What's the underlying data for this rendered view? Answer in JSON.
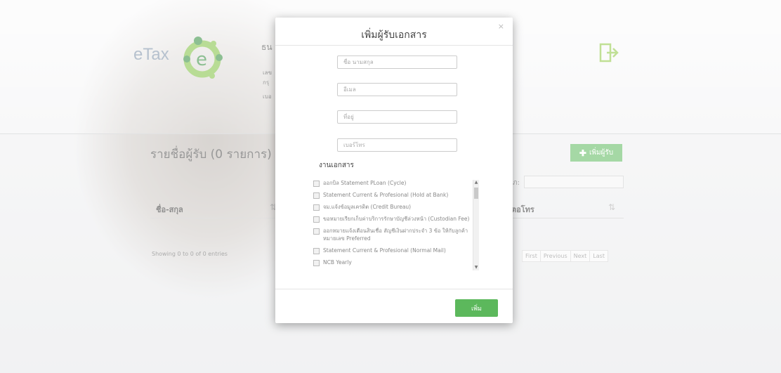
{
  "background": {
    "logo_text": "eTax",
    "header_fragments": [
      "ธน",
      "เลข",
      "กรุ",
      "เบอ"
    ],
    "list_title": "รายชื่อผู้รับ (0 รายการ)",
    "add_button_label": "เพิ่มผู้รับ",
    "search_fragment": "ภ:",
    "table": {
      "col_name": "ชื่อ-สกุล",
      "col_right": "ตอโทร",
      "showing": "Showing 0 to 0 of 0 entries"
    },
    "pager": [
      "First",
      "Previous",
      "Next",
      "Last"
    ]
  },
  "modal": {
    "title": "เพิ่มผู้รับเอกสาร",
    "close": "×",
    "fields": [
      {
        "name": "name-field",
        "placeholder": "ชื่อ นามสกุล"
      },
      {
        "name": "email-field",
        "placeholder": "อีเมล"
      },
      {
        "name": "address-field",
        "placeholder": "ที่อยู่"
      },
      {
        "name": "phone-field",
        "placeholder": "เบอร์โทร"
      }
    ],
    "section_label": "งานเอกสาร",
    "documents": [
      "ออกบิล Statement PLoan (Cycle)",
      "Statement Current & Profesional (Hold at Bank)",
      "จม.แจ้งข้อมูลเครดิต (Credit Bureau)",
      "ขอหมายเรียกเก็บค่าบริการรักษาบัญชีล่วงหน้า (Custodian Fee)",
      "ออกหมายแจ้งเตือนสินเชื่อ สัญชีเงินฝากประจำ 3 ข้อ ให้กับลูกค้าหมายเลข Preferred",
      "Statement Current & Profesional (Normal Mail)",
      "NCB Yearly"
    ],
    "submit_label": "เพิ่ม"
  },
  "colors": {
    "accent_green": "#5cb85c"
  }
}
